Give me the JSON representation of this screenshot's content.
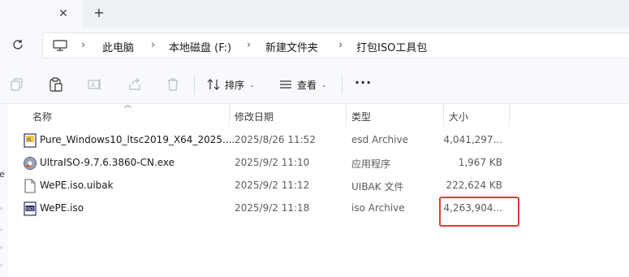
{
  "tabbar": {
    "close_glyph": "✕",
    "new_glyph": "+"
  },
  "breadcrumb": {
    "separator": "›",
    "items": [
      "此电脑",
      "本地磁盘 (F:)",
      "新建文件夹",
      "打包ISO工具包"
    ]
  },
  "toolbar": {
    "sort_label": "排序",
    "view_label": "查看",
    "more_label": "···",
    "icons": [
      "copy-icon",
      "paste-icon",
      "rename-icon",
      "share-icon",
      "delete-icon",
      "sort-icon",
      "view-icon"
    ]
  },
  "columns": {
    "name": "名称",
    "date": "修改日期",
    "type": "类型",
    "size": "大小"
  },
  "files": [
    {
      "name": "Pure_Windows10_ltsc2019_X64_2025....",
      "date": "2025/8/26 11:52",
      "type": "esd Archive",
      "size": "4,041,297...",
      "icon": "disc-image-icon"
    },
    {
      "name": "UltraISO-9.7.6.3860-CN.exe",
      "date": "2025/9/2 11:10",
      "type": "应用程序",
      "size": "1,967 KB",
      "icon": "ultraiso-app-icon"
    },
    {
      "name": "WePE.iso.uibak",
      "date": "2025/9/2 11:12",
      "type": "UIBAK 文件",
      "size": "222,624 KB",
      "icon": "blank-file-icon"
    },
    {
      "name": "WePE.iso",
      "date": "2025/9/2 11:18",
      "type": "iso Archive",
      "size": "4,263,904...",
      "icon": "iso-file-icon"
    }
  ],
  "left_pane": {
    "label": "e"
  },
  "colors": {
    "highlight": "#e53935",
    "background": "#f7f9fc"
  }
}
